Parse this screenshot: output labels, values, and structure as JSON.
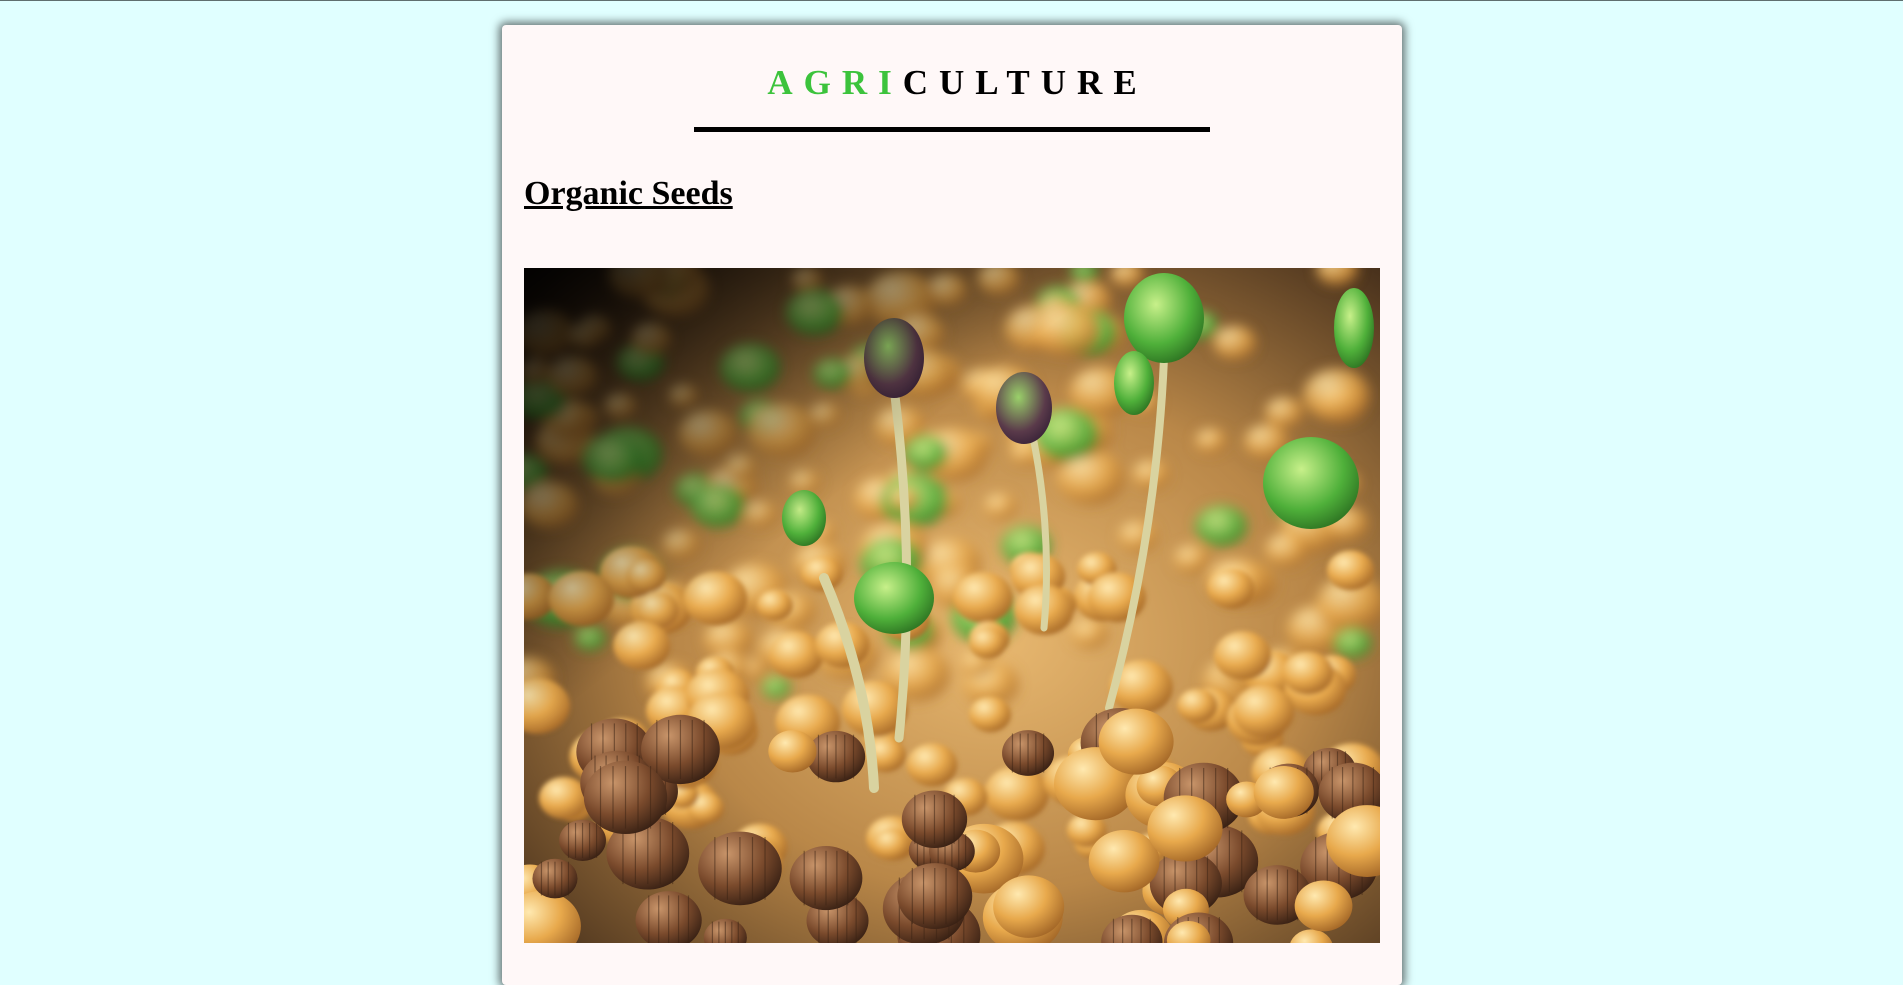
{
  "header": {
    "brand_accent": "AGRI",
    "brand_rest": "CULTURE",
    "accent_color": "#3cc33c"
  },
  "article": {
    "title": "Organic Seeds",
    "image_alt": "Close-up of sprouting organic seeds"
  },
  "colors": {
    "page_background": "#e0ffff",
    "card_background": "#fff8f8"
  }
}
